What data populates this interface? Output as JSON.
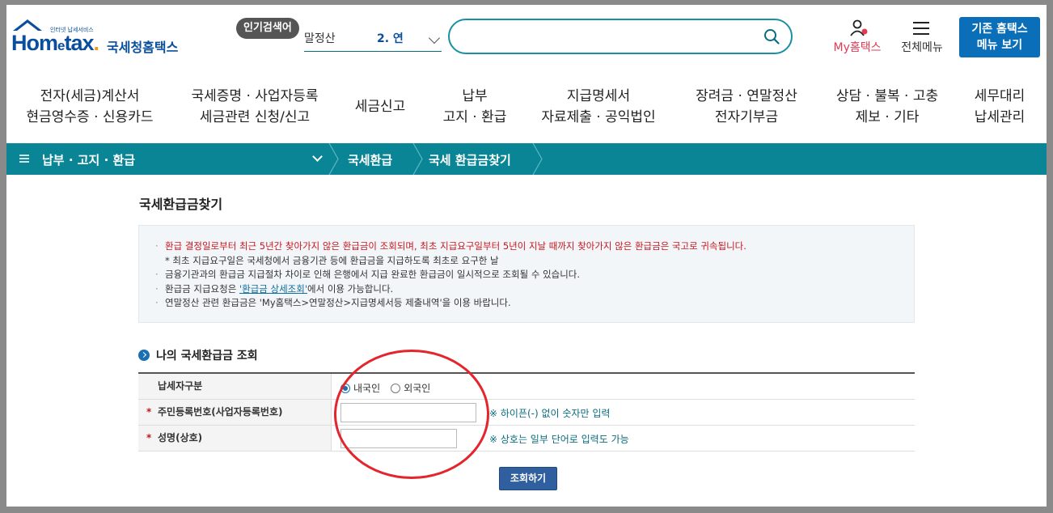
{
  "logo": {
    "tagline": "인터넷 납세서비스",
    "brand_pre": "Hom",
    "brand_e": "e",
    "brand_post": "tax",
    "brand_dot": ".",
    "name_kr": "국세청홈택스"
  },
  "header": {
    "popular_badge": "인기검색어",
    "popular_text": "말정산",
    "popular_num": "2.  연",
    "search_placeholder": "",
    "my_hometax": "My홈택스",
    "all_menu": "전체메뉴",
    "legacy_line1": "기존 홈택스",
    "legacy_line2": "메뉴 보기"
  },
  "gnb": [
    {
      "line1": "전자(세금)계산서",
      "line2": "현금영수증 · 신용카드"
    },
    {
      "line1": "국세증명 · 사업자등록",
      "line2": "세금관련 신청/신고"
    },
    {
      "line1": "세금신고",
      "line2": ""
    },
    {
      "line1": "납부",
      "line2": "고지 · 환급"
    },
    {
      "line1": "지급명세서",
      "line2": "자료제출 · 공익법인"
    },
    {
      "line1": "장려금 · 연말정산",
      "line2": "전자기부금"
    },
    {
      "line1": "상담 · 불복 · 고충",
      "line2": "제보 · 기타"
    },
    {
      "line1": "세무대리",
      "line2": "납세관리"
    }
  ],
  "breadcrumb": {
    "level1": "납부 · 고지 · 환급",
    "level2": "국세환급",
    "level3": "국세 환급금찾기"
  },
  "page": {
    "title": "국세환급금찾기"
  },
  "notice": {
    "line1": "환급 결정일로부터 최근 5년간 찾아가지 않은 환급금이 조회되며, 최초 지급요구일부터 5년이 지날 때까지 찾아가지 않은 환급금은 국고로 귀속됩니다.",
    "line1_sub": "* 최초 지급요구일은 국세청에서 금융기관 등에 환급금을 지급하도록 최초로 요구한 날",
    "line2": "금융기관과의 환급금 지급절차 차이로 인해 은행에서 지급 완료한 환급금이 일시적으로 조회될 수 있습니다.",
    "line3_pre": "환급금 지급요청은 ",
    "line3_link": "'환급금 상세조회'",
    "line3_post": "에서 이용 가능합니다.",
    "line4": "연말정산 관련 환급금은 'My홈택스>연말정산>지급명세서등 제출내역'을 이용 바랍니다."
  },
  "section": {
    "title": "나의 국세환급금 조회"
  },
  "form": {
    "taxpayer_type_label": "납세자구분",
    "radio_domestic": "내국인",
    "radio_foreign": "외국인",
    "id_label": "주민등록번호(사업자등록번호)",
    "id_hint": "※ 하이픈(-) 없이 숫자만 입력",
    "name_label": "성명(상호)",
    "name_hint": "※ 상호는 일부 단어로 입력도 가능",
    "required_mark": "*",
    "submit": "조회하기"
  },
  "colors": {
    "brand_blue": "#0a4f9c",
    "teal_bar": "#0a8595",
    "notice_red": "#c8161d",
    "annotation_red": "#e3262d",
    "submit_blue": "#2f5f9e"
  }
}
